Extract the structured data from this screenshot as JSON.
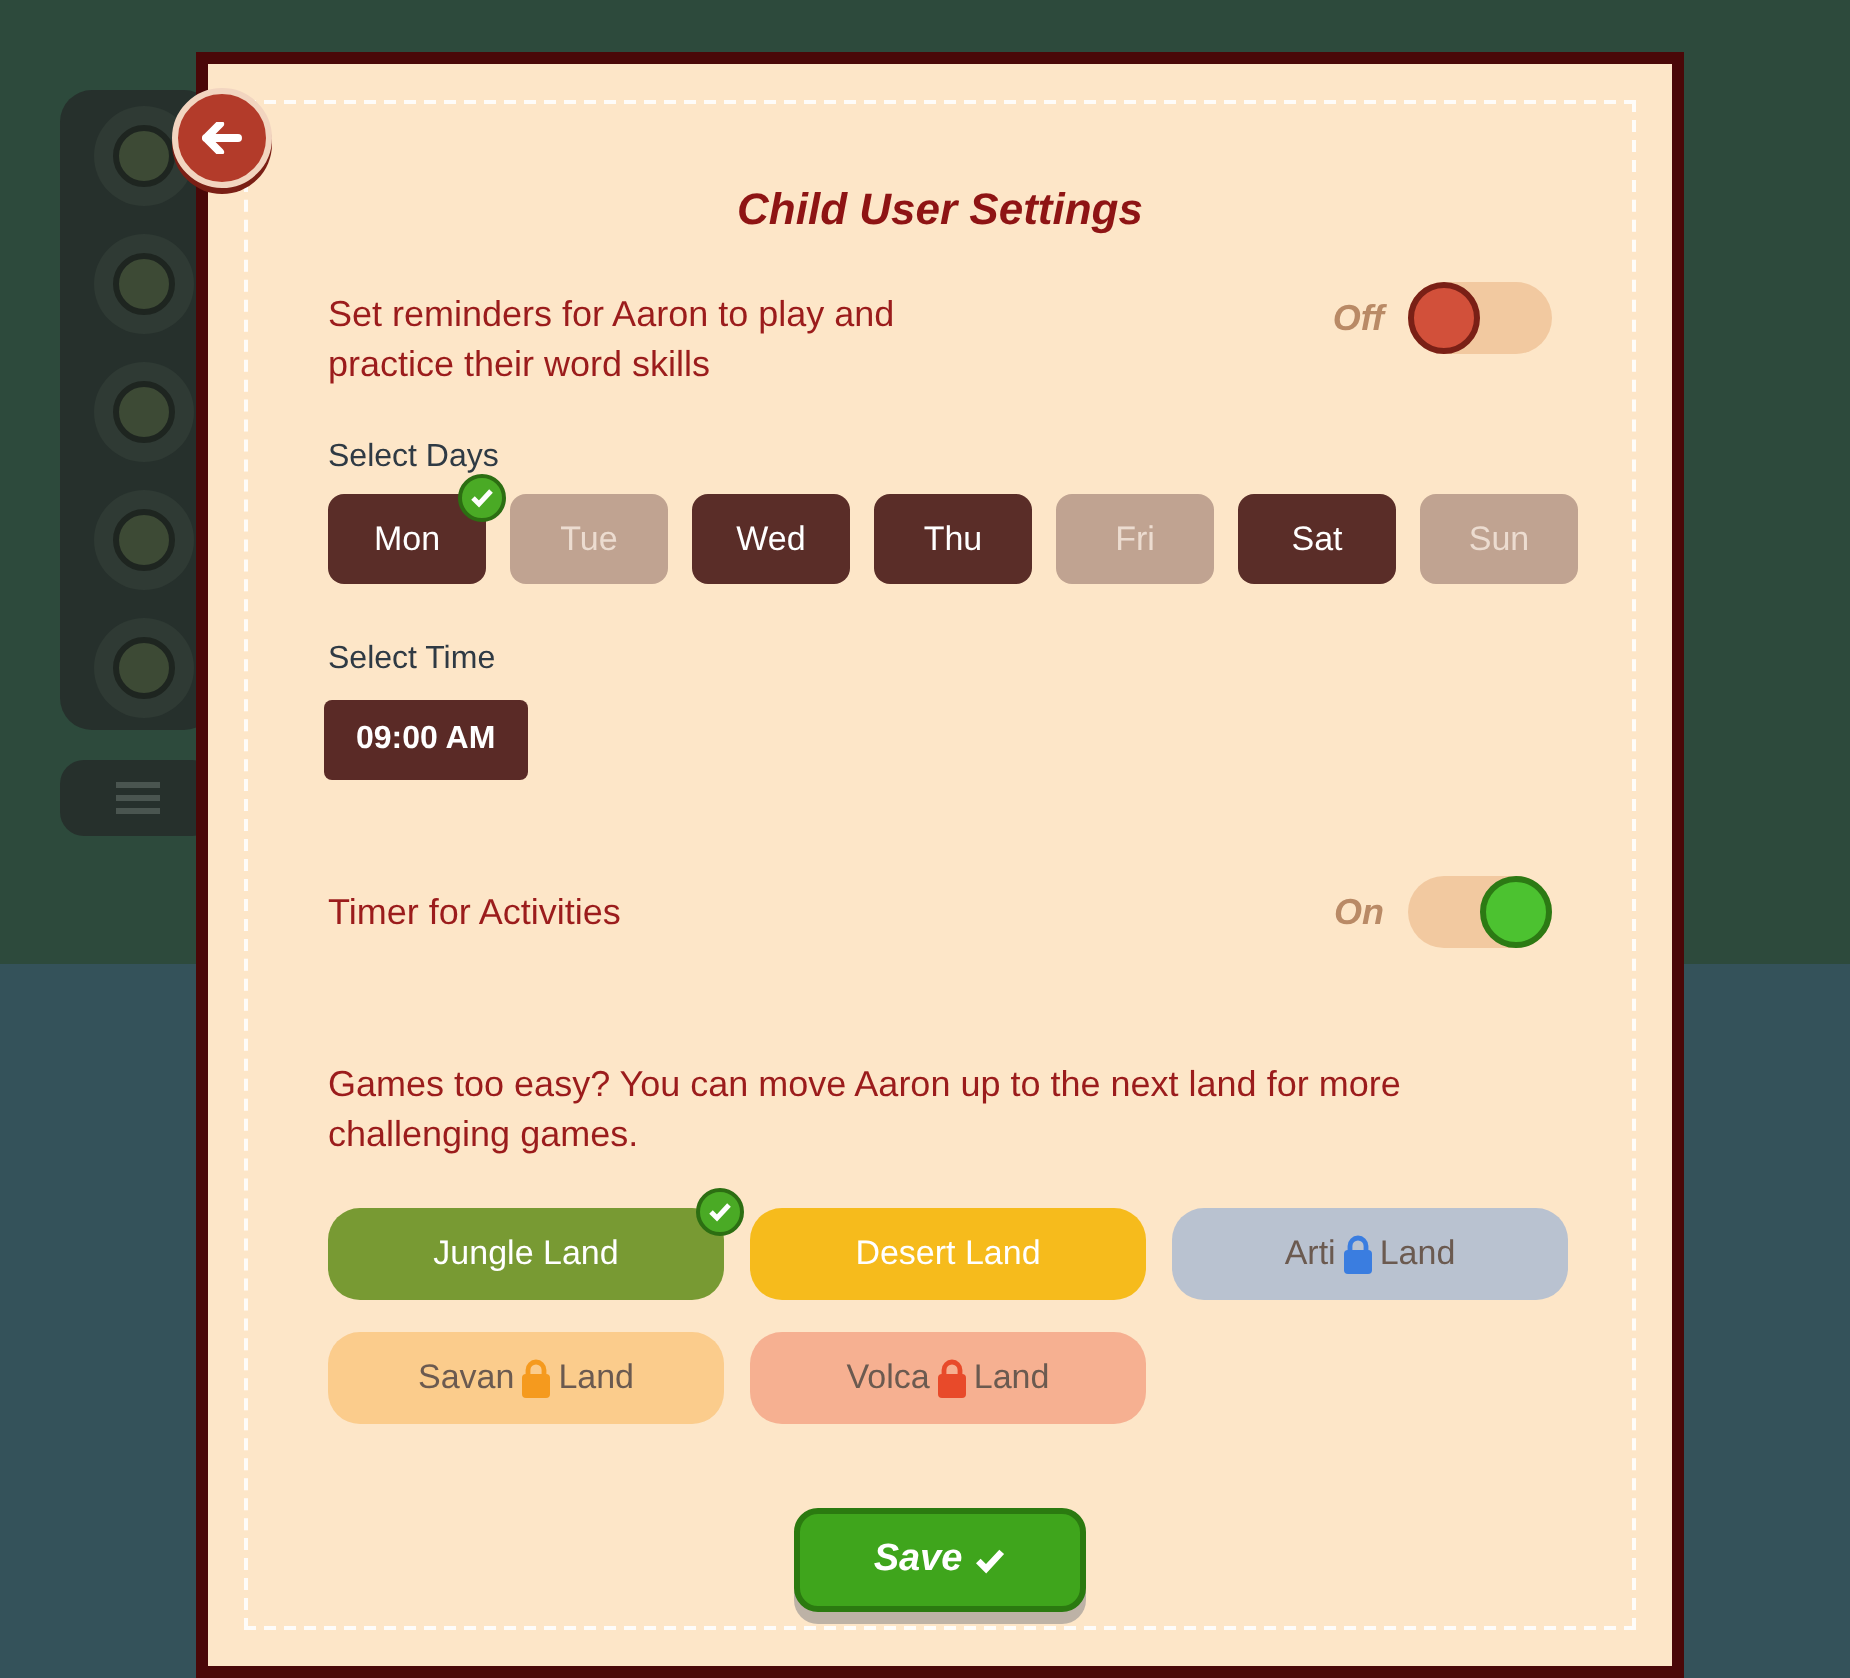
{
  "title": "Child User Settings",
  "reminder": {
    "label": "Set reminders for Aaron to play and practice their word skills",
    "state_label": "Off",
    "on": false
  },
  "days_label": "Select Days",
  "days": [
    {
      "label": "Mon",
      "selected": true,
      "checked": true
    },
    {
      "label": "Tue",
      "selected": false,
      "checked": false
    },
    {
      "label": "Wed",
      "selected": true,
      "checked": false
    },
    {
      "label": "Thu",
      "selected": true,
      "checked": false
    },
    {
      "label": "Fri",
      "selected": false,
      "checked": false
    },
    {
      "label": "Sat",
      "selected": true,
      "checked": false
    },
    {
      "label": "Sun",
      "selected": false,
      "checked": false
    }
  ],
  "time_label": "Select Time",
  "time": "09:00 AM",
  "timer": {
    "label": "Timer for Activities",
    "state_label": "On",
    "on": true
  },
  "lands_intro": "Games too easy? You can move Aaron up to the next land for more challenging games.",
  "lands": [
    {
      "text_parts": [
        "Jungle Land"
      ],
      "locked": false,
      "selected": true,
      "color": "#789a33"
    },
    {
      "text_parts": [
        "Desert Land"
      ],
      "locked": false,
      "selected": false,
      "color": "#f6bb1c"
    },
    {
      "text_parts": [
        "Arti",
        "Land"
      ],
      "locked": true,
      "selected": false,
      "color": "#3a7de0"
    },
    {
      "text_parts": [
        "Savan",
        "Land"
      ],
      "locked": true,
      "selected": false,
      "color": "#f59a1e"
    },
    {
      "text_parts": [
        "Volca",
        "Land"
      ],
      "locked": true,
      "selected": false,
      "color": "#e84a2a"
    }
  ],
  "save_button": "Save"
}
